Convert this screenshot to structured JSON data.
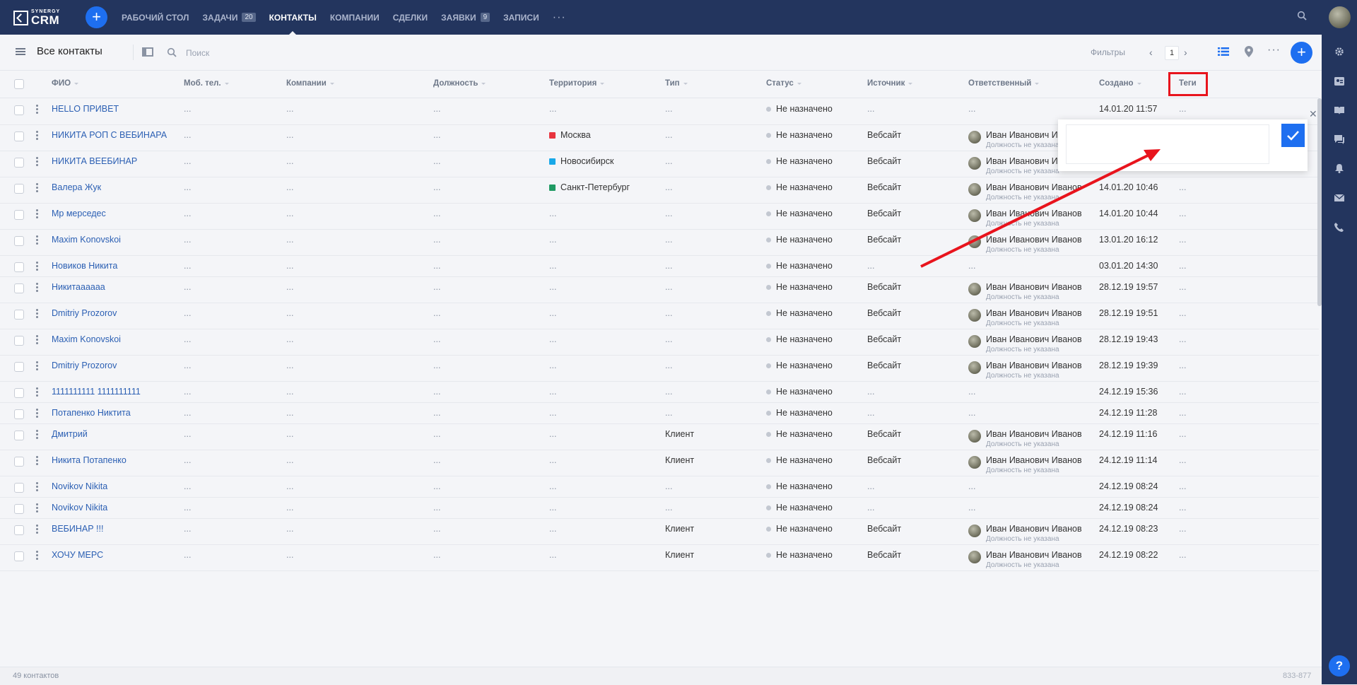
{
  "brand": {
    "top": "SYNERGY",
    "main": "CRM"
  },
  "nav": [
    {
      "label": "РАБОЧИЙ СТОЛ",
      "badge": "",
      "active": false
    },
    {
      "label": "ЗАДАЧИ",
      "badge": "20",
      "active": false
    },
    {
      "label": "КОНТАКТЫ",
      "badge": "",
      "active": true
    },
    {
      "label": "КОМПАНИИ",
      "badge": "",
      "active": false
    },
    {
      "label": "СДЕЛКИ",
      "badge": "",
      "active": false
    },
    {
      "label": "ЗАЯВКИ",
      "badge": "9",
      "active": false
    },
    {
      "label": "ЗАПИСИ",
      "badge": "",
      "active": false
    }
  ],
  "toolbar": {
    "title": "Все контакты",
    "search_placeholder": "Поиск",
    "filters_label": "Фильтры",
    "page": "1"
  },
  "columns": {
    "name": "ФИО",
    "phone": "Моб. тел.",
    "company": "Компании",
    "position": "Должность",
    "territory": "Территория",
    "type": "Тип",
    "status": "Статус",
    "source": "Источник",
    "responsible": "Ответственный",
    "created": "Создано",
    "tags": "Теги"
  },
  "colors": {
    "accent": "#1e6ff0",
    "topbar": "#23355e",
    "highlight": "#e8141d",
    "moscow": "#e8343e",
    "novosibirsk": "#18a8e8",
    "spb": "#1f9a63"
  },
  "placeholder": "...",
  "rows": [
    {
      "name": "HELLO ПРИВЕТ",
      "territory": "",
      "type": "",
      "status": "Не назначено",
      "source": "",
      "resp_name": "",
      "resp_pos": "",
      "created": "14.01.20 11:57"
    },
    {
      "name": "НИКИТА РОП С ВЕБИНАРА",
      "territory": "Москва",
      "territory_color": "#e8343e",
      "type": "",
      "status": "Не назначено",
      "source": "Вебсайт",
      "resp_name": "Иван Иванович Иванов",
      "resp_pos": "Должность не указана",
      "created": ""
    },
    {
      "name": "НИКИТА ВЕЕБИНАР",
      "territory": "Новосибирск",
      "territory_color": "#18a8e8",
      "type": "",
      "status": "Не назначено",
      "source": "Вебсайт",
      "resp_name": "Иван Иванович Иванов",
      "resp_pos": "Должность не указана",
      "created": ""
    },
    {
      "name": "Валера Жук",
      "territory": "Санкт-Петербург",
      "territory_color": "#1f9a63",
      "type": "",
      "status": "Не назначено",
      "source": "Вебсайт",
      "resp_name": "Иван Иванович Иванов",
      "resp_pos": "Должность не указана",
      "created": "14.01.20 10:46"
    },
    {
      "name": "Мр мерседес",
      "territory": "",
      "type": "",
      "status": "Не назначено",
      "source": "Вебсайт",
      "resp_name": "Иван Иванович Иванов",
      "resp_pos": "Должность не указана",
      "created": "14.01.20 10:44"
    },
    {
      "name": "Maxim Konovskoi",
      "territory": "",
      "type": "",
      "status": "Не назначено",
      "source": "Вебсайт",
      "resp_name": "Иван Иванович Иванов",
      "resp_pos": "Должность не указана",
      "created": "13.01.20 16:12"
    },
    {
      "name": "Новиков Никита",
      "territory": "",
      "type": "",
      "status": "Не назначено",
      "source": "",
      "resp_name": "",
      "resp_pos": "",
      "created": "03.01.20 14:30"
    },
    {
      "name": "Никитаааааа",
      "territory": "",
      "type": "",
      "status": "Не назначено",
      "source": "Вебсайт",
      "resp_name": "Иван Иванович Иванов",
      "resp_pos": "Должность не указана",
      "created": "28.12.19 19:57"
    },
    {
      "name": "Dmitriy Prozorov",
      "territory": "",
      "type": "",
      "status": "Не назначено",
      "source": "Вебсайт",
      "resp_name": "Иван Иванович Иванов",
      "resp_pos": "Должность не указана",
      "created": "28.12.19 19:51"
    },
    {
      "name": "Maxim Konovskoi",
      "territory": "",
      "type": "",
      "status": "Не назначено",
      "source": "Вебсайт",
      "resp_name": "Иван Иванович Иванов",
      "resp_pos": "Должность не указана",
      "created": "28.12.19 19:43"
    },
    {
      "name": "Dmitriy Prozorov",
      "territory": "",
      "type": "",
      "status": "Не назначено",
      "source": "Вебсайт",
      "resp_name": "Иван Иванович Иванов",
      "resp_pos": "Должность не указана",
      "created": "28.12.19 19:39"
    },
    {
      "name": "1111111111 1111111111",
      "territory": "",
      "type": "",
      "status": "Не назначено",
      "source": "",
      "resp_name": "",
      "resp_pos": "",
      "created": "24.12.19 15:36"
    },
    {
      "name": "Потапенко Никтита",
      "territory": "",
      "type": "",
      "status": "Не назначено",
      "source": "",
      "resp_name": "",
      "resp_pos": "",
      "created": "24.12.19 11:28"
    },
    {
      "name": "Дмитрий",
      "territory": "",
      "type": "Клиент",
      "status": "Не назначено",
      "source": "Вебсайт",
      "resp_name": "Иван Иванович Иванов",
      "resp_pos": "Должность не указана",
      "created": "24.12.19 11:16"
    },
    {
      "name": "Никита Потапенко",
      "territory": "",
      "type": "Клиент",
      "status": "Не назначено",
      "source": "Вебсайт",
      "resp_name": "Иван Иванович Иванов",
      "resp_pos": "Должность не указана",
      "created": "24.12.19 11:14"
    },
    {
      "name": "Novikov Nikita",
      "territory": "",
      "type": "",
      "status": "Не назначено",
      "source": "",
      "resp_name": "",
      "resp_pos": "",
      "created": "24.12.19 08:24"
    },
    {
      "name": "Novikov Nikita",
      "territory": "",
      "type": "",
      "status": "Не назначено",
      "source": "",
      "resp_name": "",
      "resp_pos": "",
      "created": "24.12.19 08:24"
    },
    {
      "name": "ВЕБИНАР !!!",
      "territory": "",
      "type": "Клиент",
      "status": "Не назначено",
      "source": "Вебсайт",
      "resp_name": "Иван Иванович Иванов",
      "resp_pos": "Должность не указана",
      "created": "24.12.19 08:23"
    },
    {
      "name": "ХОЧУ МЕРС",
      "territory": "",
      "type": "Клиент",
      "status": "Не назначено",
      "source": "Вебсайт",
      "resp_name": "Иван Иванович Иванов",
      "resp_pos": "Должность не указана",
      "created": "24.12.19 08:22"
    }
  ],
  "footer": {
    "count": "49 контактов",
    "version": "833-877"
  },
  "tag_editor": {
    "value": ""
  },
  "right_icons": [
    "gear-icon",
    "contact-card-icon",
    "book-icon",
    "chat-icon",
    "bell-icon",
    "mail-icon",
    "phone-icon"
  ]
}
